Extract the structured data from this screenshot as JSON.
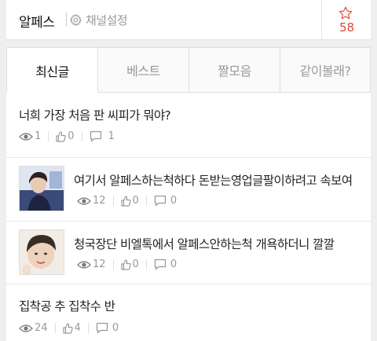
{
  "header": {
    "channel_title": "알페스",
    "settings_label": "채널설정",
    "favorite_count": "58"
  },
  "tabs": [
    {
      "label": "최신글",
      "active": true
    },
    {
      "label": "베스트",
      "active": false
    },
    {
      "label": "짤모음",
      "active": false
    },
    {
      "label": "같이볼래?",
      "active": false
    }
  ],
  "posts": [
    {
      "title": "너희 가장 처음 판 씨피가 뭐야?",
      "views": "1",
      "likes": "0",
      "comments": "1",
      "has_thumb": false
    },
    {
      "title": "여기서 알페스하는척하다 돈받는영업글팔이하려고 속보여",
      "views": "12",
      "likes": "0",
      "comments": "0",
      "has_thumb": true
    },
    {
      "title": "청국장단 비엘톡에서 알페스안하는척 개욕하더니 깔깔",
      "views": "12",
      "likes": "0",
      "comments": "0",
      "has_thumb": true
    },
    {
      "title": "집착공 추 집착수 반",
      "views": "24",
      "likes": "4",
      "comments": "0",
      "has_thumb": false
    }
  ],
  "colors": {
    "accent": "#e2473b",
    "meta": "#999999",
    "border": "#dedede"
  },
  "icons": {
    "views": "eye-icon",
    "likes": "thumbs-up-icon",
    "comments": "comment-icon",
    "settings": "gear-icon",
    "favorite": "star-icon"
  }
}
